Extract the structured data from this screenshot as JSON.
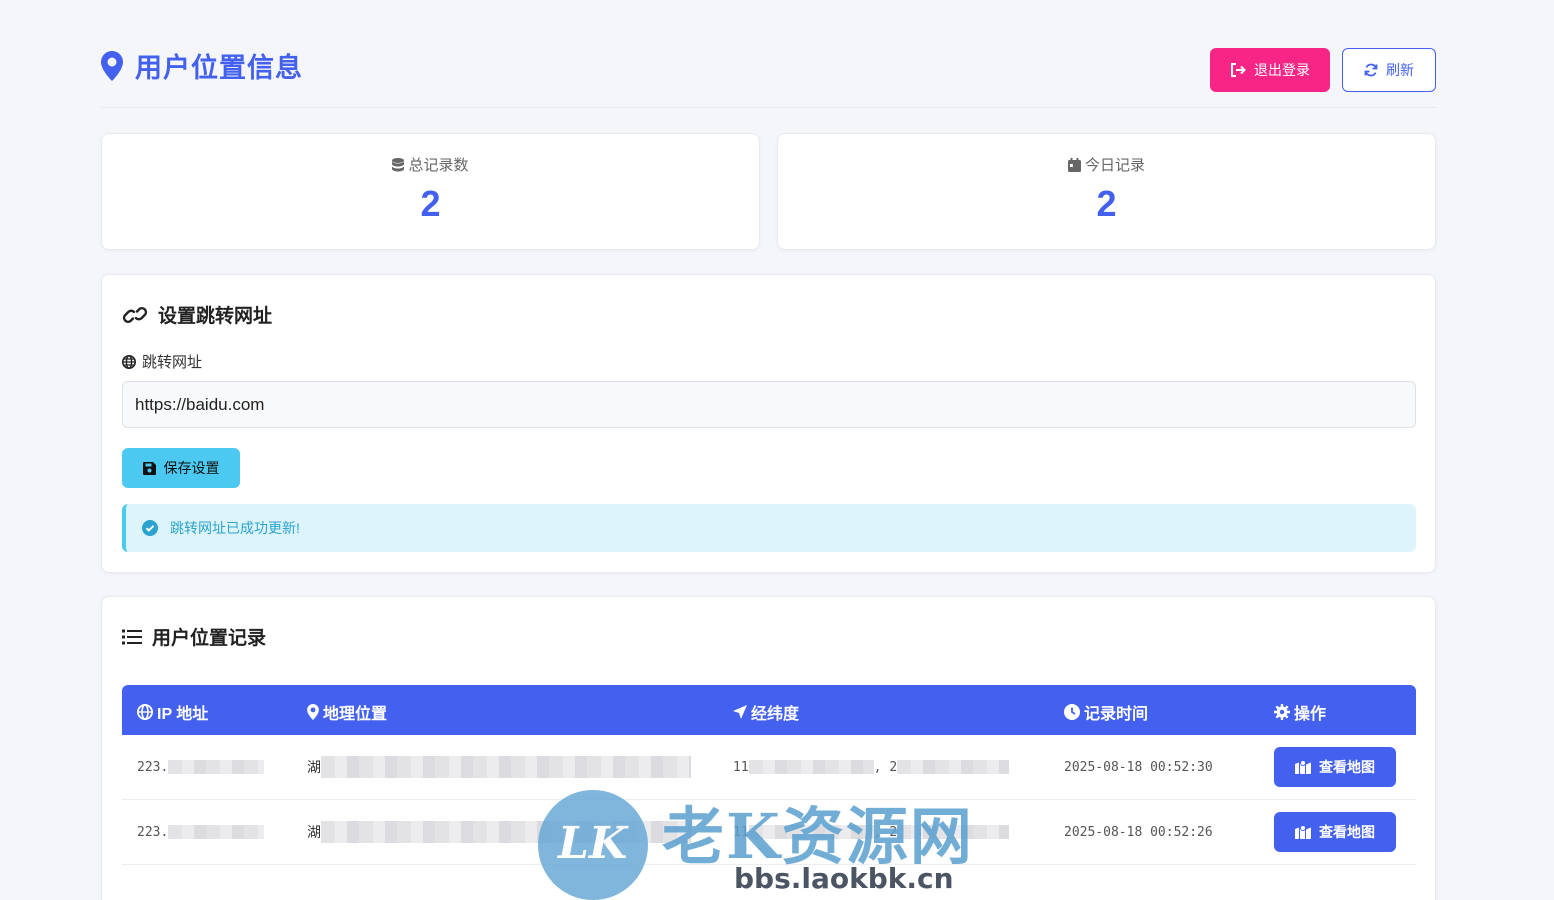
{
  "header": {
    "title": "用户位置信息",
    "logout_label": "退出登录",
    "refresh_label": "刷新"
  },
  "stats": [
    {
      "label": "总记录数",
      "value": "2",
      "icon": "database-icon"
    },
    {
      "label": "今日记录",
      "value": "2",
      "icon": "calendar-icon"
    }
  ],
  "settings": {
    "title": "设置跳转网址",
    "field_label": "跳转网址",
    "url_value": "https://baidu.com",
    "save_label": "保存设置",
    "alert": "跳转网址已成功更新!"
  },
  "records": {
    "title": "用户位置记录",
    "columns": [
      "IP 地址",
      "地理位置",
      "经纬度",
      "记录时间",
      "操作"
    ],
    "rows": [
      {
        "ip": "223.",
        "location": "湖",
        "coords_a": "11",
        "coords_sep": ",",
        "coords_b": "2",
        "time": "2025-08-18 00:52:30",
        "action": "查看地图"
      },
      {
        "ip": "223.",
        "location": "湖",
        "coords_a": "11",
        "coords_sep": ",",
        "coords_b": "2",
        "time": "2025-08-18 00:52:26",
        "action": "查看地图"
      }
    ]
  },
  "watermark": {
    "logo": "LK",
    "text": "老K资源网",
    "url": "bbs.laokbk.cn"
  },
  "colors": {
    "primary": "#4361ee",
    "danger": "#f72585",
    "info": "#4cc9f0",
    "background": "#f5f6fa"
  }
}
